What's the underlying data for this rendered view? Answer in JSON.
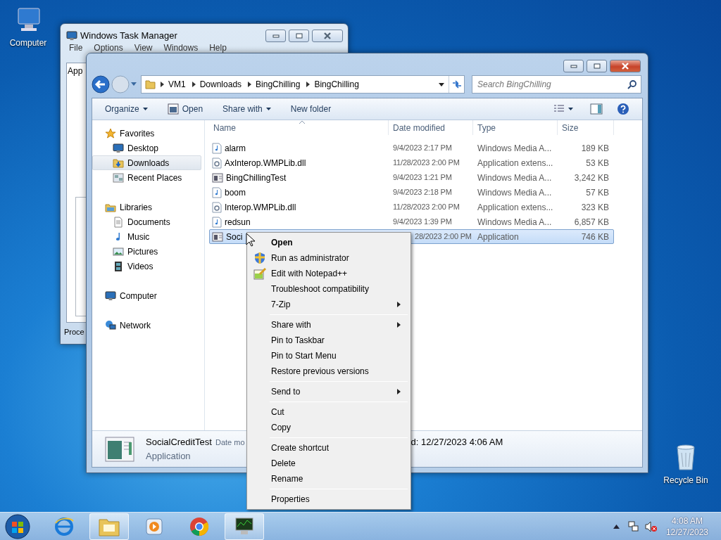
{
  "desktop_icons": [
    {
      "label": "Computer"
    },
    {
      "label": "Recycle Bin"
    }
  ],
  "task_manager": {
    "title": "Windows Task Manager",
    "menu": [
      "File",
      "Options",
      "View",
      "Windows",
      "Help"
    ],
    "tab": "App",
    "status": "Proce"
  },
  "explorer": {
    "breadcrumbs": [
      "VM1",
      "Downloads",
      "BingChilling",
      "BingChilling"
    ],
    "search": {
      "placeholder": "Search BingChilling"
    },
    "toolbar": [
      {
        "label": "Organize",
        "dropdown": true
      },
      {
        "label": "Open",
        "dropdown": false
      },
      {
        "label": "Share with",
        "dropdown": true
      },
      {
        "label": "New folder",
        "dropdown": false
      }
    ],
    "nav": [
      {
        "label": "Favorites",
        "selected": false,
        "children": [
          {
            "label": "Desktop",
            "selected": false
          },
          {
            "label": "Downloads",
            "selected": true
          },
          {
            "label": "Recent Places",
            "selected": false
          }
        ]
      },
      {
        "label": "Libraries",
        "selected": false,
        "children": [
          {
            "label": "Documents",
            "selected": false
          },
          {
            "label": "Music",
            "selected": false
          },
          {
            "label": "Pictures",
            "selected": false
          },
          {
            "label": "Videos",
            "selected": false
          }
        ]
      },
      {
        "label": "Computer",
        "selected": false
      },
      {
        "label": "Network",
        "selected": false
      }
    ],
    "columns": [
      "Name",
      "Date modified",
      "Type",
      "Size"
    ],
    "files": [
      {
        "name": "alarm",
        "date": "9/4/2023 2:17 PM",
        "type": "Windows Media A...",
        "size": "189 KB",
        "selected": false
      },
      {
        "name": "AxInterop.WMPLib.dll",
        "date": "11/28/2023 2:00 PM",
        "type": "Application extens...",
        "size": "53 KB",
        "selected": false
      },
      {
        "name": "BingChillingTest",
        "date": "9/4/2023 1:21 PM",
        "type": "Windows Media A...",
        "size": "3,242 KB",
        "selected": false
      },
      {
        "name": "boom",
        "date": "9/4/2023 2:18 PM",
        "type": "Windows Media A...",
        "size": "57 KB",
        "selected": false
      },
      {
        "name": "Interop.WMPLib.dll",
        "date": "11/28/2023 2:00 PM",
        "type": "Application extens...",
        "size": "323 KB",
        "selected": false
      },
      {
        "name": "redsun",
        "date": "9/4/2023 1:39 PM",
        "type": "Windows Media A...",
        "size": "6,857 KB",
        "selected": false
      },
      {
        "name": "Soci",
        "date": "28/2023 2:00 PM",
        "type": "Application",
        "size": "746 KB",
        "selected": true
      }
    ],
    "details": {
      "name": "SocialCreditTest",
      "field_1": "Date mo",
      "field_2": "d: 12/27/2023 4:06 AM",
      "type": "Application"
    }
  },
  "context_menu": [
    {
      "kind": "item",
      "label": "Open",
      "default": true,
      "submenu": false
    },
    {
      "kind": "item",
      "label": "Run as administrator",
      "default": false,
      "submenu": false
    },
    {
      "kind": "item",
      "label": "Edit with Notepad++",
      "default": false,
      "submenu": false
    },
    {
      "kind": "item",
      "label": "Troubleshoot compatibility",
      "default": false,
      "submenu": false
    },
    {
      "kind": "item",
      "label": "7-Zip",
      "default": false,
      "submenu": true
    },
    {
      "kind": "separator"
    },
    {
      "kind": "item",
      "label": "Share with",
      "default": false,
      "submenu": true
    },
    {
      "kind": "item",
      "label": "Pin to Taskbar",
      "default": false,
      "submenu": false
    },
    {
      "kind": "item",
      "label": "Pin to Start Menu",
      "default": false,
      "submenu": false
    },
    {
      "kind": "item",
      "label": "Restore previous versions",
      "default": false,
      "submenu": false
    },
    {
      "kind": "separator"
    },
    {
      "kind": "item",
      "label": "Send to",
      "default": false,
      "submenu": true
    },
    {
      "kind": "separator"
    },
    {
      "kind": "item",
      "label": "Cut",
      "default": false,
      "submenu": false
    },
    {
      "kind": "item",
      "label": "Copy",
      "default": false,
      "submenu": false
    },
    {
      "kind": "separator"
    },
    {
      "kind": "item",
      "label": "Create shortcut",
      "default": false,
      "submenu": false
    },
    {
      "kind": "item",
      "label": "Delete",
      "default": false,
      "submenu": false
    },
    {
      "kind": "item",
      "label": "Rename",
      "default": false,
      "submenu": false
    },
    {
      "kind": "separator"
    },
    {
      "kind": "item",
      "label": "Properties",
      "default": false,
      "submenu": false
    }
  ],
  "taskbar": {
    "apps": [
      {
        "running": false
      },
      {
        "running": true
      },
      {
        "running": false
      },
      {
        "running": false
      },
      {
        "running": true
      }
    ],
    "clock": {
      "time": "4:08 AM",
      "date": "12/27/2023"
    }
  }
}
